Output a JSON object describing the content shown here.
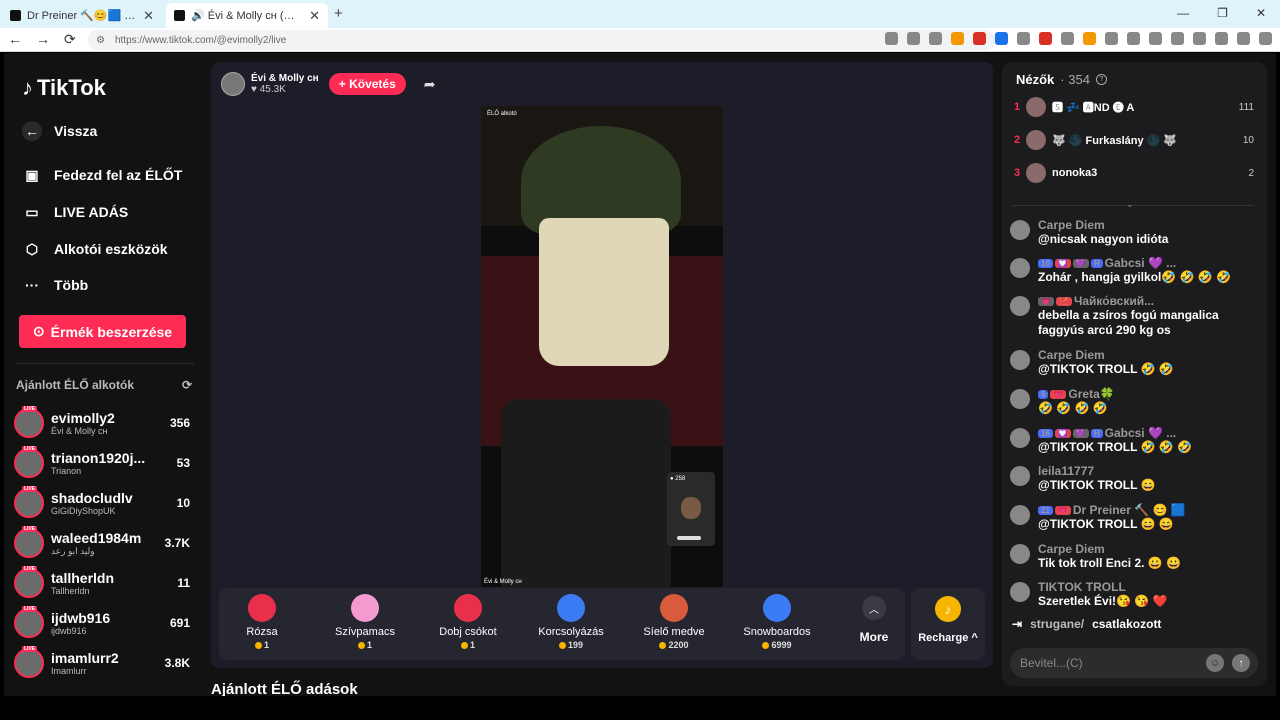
{
  "browser": {
    "tabs": [
      {
        "label": "Dr Preiner 🔨😊🟦 (@preiner) ÉLŐ"
      },
      {
        "label": "🔊 Évi & Molly ᴄʜ (@evimolly2) É"
      }
    ],
    "url": "https://www.tiktok.com/@evimolly2/live",
    "new_tab": "+",
    "window_controls": [
      "—",
      "❐",
      "✕"
    ],
    "nav": [
      "←",
      "→",
      "⟳",
      "🔖"
    ]
  },
  "sidebar": {
    "logo": "TikTok",
    "back": "Vissza",
    "nav": [
      {
        "label": "Fedezd fel az ÉLŐT",
        "icon": "live-tv-icon"
      },
      {
        "label": "LIVE ADÁS",
        "icon": "camera-icon"
      },
      {
        "label": "Alkotói eszközök",
        "icon": "creator-tools-icon"
      },
      {
        "label": "Több",
        "icon": "more-dots-icon"
      }
    ],
    "coin_button": "Érmék beszerzése",
    "recommended_header": "Ajánlott ÉLŐ alkotók",
    "creators": [
      {
        "name": "evimolly2",
        "sub": "Évi & Molly ᴄʜ",
        "count": "356"
      },
      {
        "name": "trianon1920j...",
        "sub": "Trianon",
        "count": "53"
      },
      {
        "name": "shadocludlv",
        "sub": "GiGiDiyShopUK",
        "count": "10"
      },
      {
        "name": "waleed1984m",
        "sub": "وليد ابو رعد",
        "count": "3.7K"
      },
      {
        "name": "tallherldn",
        "sub": "Tallherldn",
        "count": "11"
      },
      {
        "name": "ijdwb916",
        "sub": "ijdwb916",
        "count": "691"
      },
      {
        "name": "imamlurr2",
        "sub": "Imamlurr",
        "count": "3.8K"
      }
    ],
    "live_badge": "LIVE"
  },
  "stream": {
    "host_name": "Évi & Molly ᴄʜ",
    "host_likes": "♥ 45.3K",
    "follow": "+ Követés",
    "video_label": "ÉLŐ alkotó",
    "video_name": "Évi & Molly ᴄʜ",
    "pip_viewers": "● 258",
    "gifts": [
      {
        "name": "Rózsa",
        "price": "1",
        "color": "#e8304a"
      },
      {
        "name": "Szívpamacs",
        "price": "1",
        "color": "#f59ad0"
      },
      {
        "name": "Dobj csókot",
        "price": "1",
        "color": "#e8304a"
      },
      {
        "name": "Korcsolyázás",
        "price": "199",
        "color": "#3b7cf5"
      },
      {
        "name": "Síelő medve",
        "price": "2200",
        "color": "#d95a3c"
      },
      {
        "name": "Snowboardos",
        "price": "6999",
        "color": "#3b7cf5"
      }
    ],
    "more": "More",
    "recharge": "Recharge ^",
    "bottom_heading": "Ajánlott ÉLŐ adások"
  },
  "chat": {
    "viewers_title": "Nézők",
    "viewers_count": "· 354",
    "ranking": [
      {
        "rank": "1",
        "name": "🆂 💤 🅰ND 🅔 A",
        "score": "111"
      },
      {
        "rank": "2",
        "name": "🐺 🌑 Furkaslány 🌑 🐺",
        "score": "10"
      },
      {
        "rank": "3",
        "name": "nonoka3",
        "score": "2"
      }
    ],
    "messages": [
      {
        "user": "Carpe Diem",
        "badges": [],
        "text": "@nicsak nagyon idióta"
      },
      {
        "user": "Gabcsi 💜 ...",
        "badges": [
          "16",
          "💟",
          "💜",
          "H"
        ],
        "text": "Zohár , hangja gyilkol🤣 🤣 🤣 🤣"
      },
      {
        "user": "Чайко́вский...",
        "badges": [
          "💗",
          "🏹"
        ],
        "text": "debella a zsíros fogú mangalica faggyús arcú 290 kg os"
      },
      {
        "user": "Carpe Diem",
        "badges": [],
        "text": "@TIKTOK TROLL 🤣 🤣"
      },
      {
        "user": "Greta🍀",
        "badges": [
          "9",
          "💗"
        ],
        "text": "🤣 🤣 🤣 🤣"
      },
      {
        "user": "Gabcsi 💜 ...",
        "badges": [
          "16",
          "💟",
          "💜",
          "H"
        ],
        "text": "@TIKTOK TROLL 🤣 🤣 🤣"
      },
      {
        "user": "leila11777",
        "badges": [],
        "text": "@TIKTOK TROLL 😄"
      },
      {
        "user": "Dr Preiner 🔨 😊 🟦",
        "badges": [
          "21",
          "💗"
        ],
        "text": "@TIKTOK TROLL 😄 😄"
      },
      {
        "user": "Carpe Diem",
        "badges": [],
        "text": "Tik tok troll Enci 2. 😀 😀"
      },
      {
        "user": "TIKTOK TROLL",
        "badges": [],
        "text": "Szeretlek Évi!😘 😘 ❤️"
      }
    ],
    "join_user": "strugane/",
    "join_text": "csatlakozott",
    "input_placeholder": "Bevitel...(C)"
  }
}
